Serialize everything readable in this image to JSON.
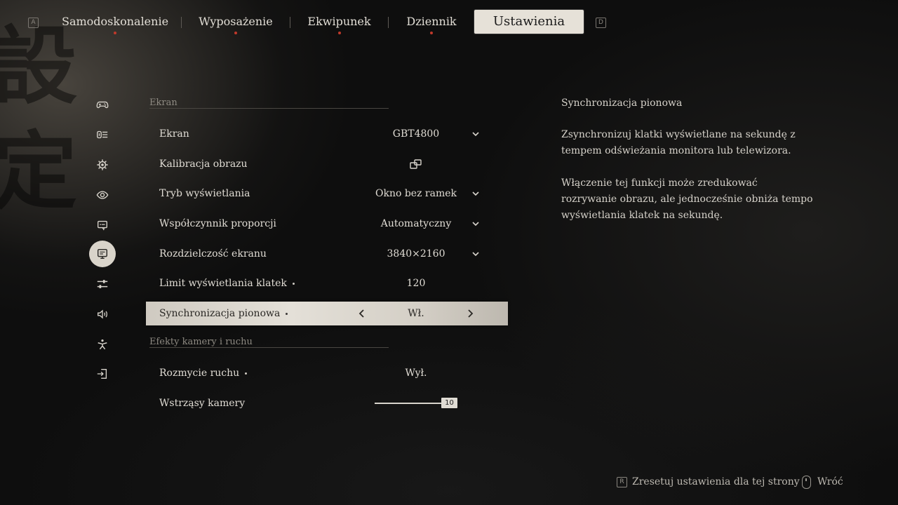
{
  "nav": {
    "left_key": "A",
    "right_key": "D",
    "tabs": [
      {
        "label": "Samodoskonalenie",
        "dot": true
      },
      {
        "label": "Wyposażenie",
        "dot": true
      },
      {
        "label": "Ekwipunek",
        "dot": true
      },
      {
        "label": "Dziennik",
        "dot": true
      },
      {
        "label": "Ustawienia",
        "dot": false,
        "active": true
      }
    ]
  },
  "sidebar": {
    "items": [
      {
        "icon": "gamepad-icon"
      },
      {
        "icon": "controls-icon"
      },
      {
        "icon": "gear-icon"
      },
      {
        "icon": "eye-icon"
      },
      {
        "icon": "chat-icon"
      },
      {
        "icon": "monitor-icon",
        "active": true
      },
      {
        "icon": "sliders-icon"
      },
      {
        "icon": "speaker-icon"
      },
      {
        "icon": "accessibility-icon"
      },
      {
        "icon": "exit-icon"
      }
    ]
  },
  "sections": {
    "display": {
      "title": "Ekran",
      "rows": [
        {
          "label": "Ekran",
          "value": "GBT4800"
        },
        {
          "label": "Kalibracja obrazu"
        },
        {
          "label": "Tryb wyświetlania",
          "value": "Okno bez ramek"
        },
        {
          "label": "Współczynnik proporcji",
          "value": "Automatyczny"
        },
        {
          "label": "Rozdzielczość ekranu",
          "value": "3840×2160"
        },
        {
          "label": "Limit wyświetlania klatek",
          "value": "120"
        },
        {
          "label": "Synchronizacja pionowa",
          "value": "Wł."
        }
      ]
    },
    "camera": {
      "title": "Efekty kamery i ruchu",
      "rows": [
        {
          "label": "Rozmycie ruchu",
          "value": "Wył."
        },
        {
          "label": "Wstrząsy kamery",
          "value": "10",
          "slider_fraction": 1.0
        }
      ]
    }
  },
  "description": {
    "title": "Synchronizacja pionowa",
    "p1": "Zsynchronizuj klatki wyświetlane na sekundę z tempem odświeżania monitora lub telewizora.",
    "p2": "Włączenie tej funkcji może zredukować rozrywanie obrazu, ale jednocześnie obniża tempo wyświetlania klatek na sekundę."
  },
  "footer": {
    "reset_key": "R",
    "reset_label": "Zresetuj ustawienia dla tej strony",
    "back_label": "Wróć"
  },
  "colors": {
    "accent_dot": "#c0392b",
    "active_tab_bg": "#e6e1d8",
    "selected_row_bg": "#dcd7ce"
  }
}
